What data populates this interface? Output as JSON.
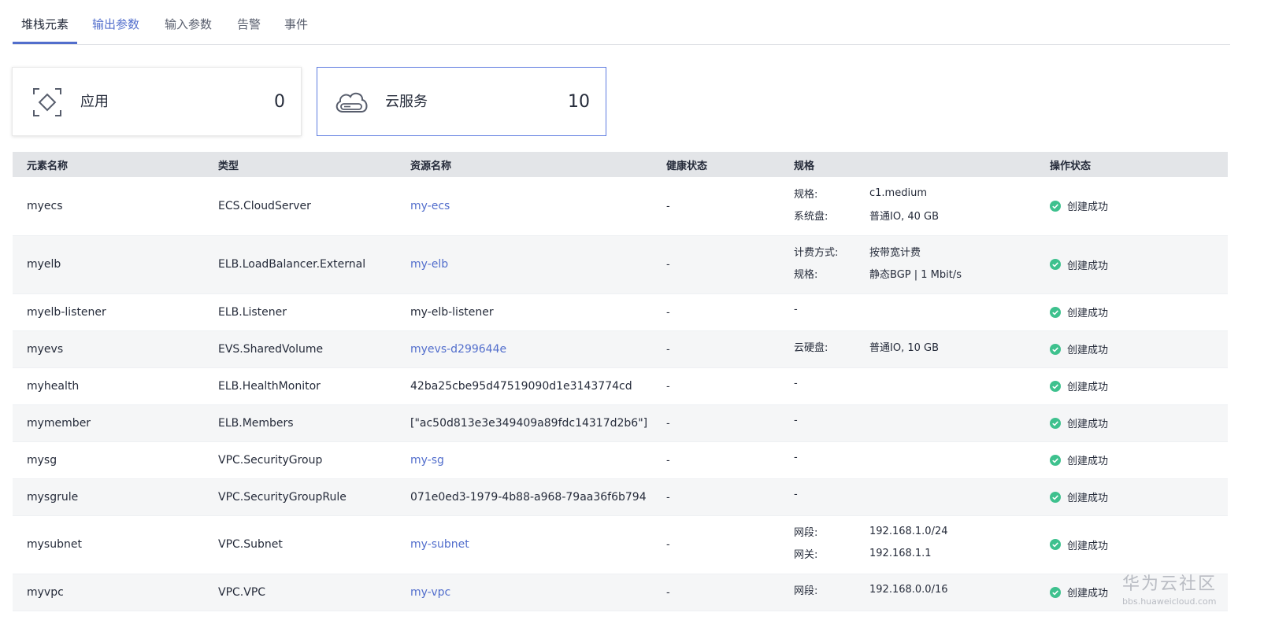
{
  "tabs": [
    {
      "label": "堆栈元素"
    },
    {
      "label": "输出参数"
    },
    {
      "label": "输入参数"
    },
    {
      "label": "告警"
    },
    {
      "label": "事件"
    }
  ],
  "cards": {
    "app": {
      "label": "应用",
      "count": "0",
      "icon": "app-frame-icon"
    },
    "cloud": {
      "label": "云服务",
      "count": "10",
      "icon": "cloud-icon"
    }
  },
  "table": {
    "headers": [
      "元素名称",
      "类型",
      "资源名称",
      "健康状态",
      "规格",
      "操作状态"
    ],
    "rows": [
      {
        "name": "myecs",
        "type": "ECS.CloudServer",
        "resource": "my-ecs",
        "resource_link": true,
        "health": "-",
        "status": "创建成功",
        "spec": [
          {
            "k": "规格:",
            "v": "c1.medium"
          },
          {
            "k": "系统盘:",
            "v": "普通IO, 40 GB"
          }
        ]
      },
      {
        "name": "myelb",
        "type": "ELB.LoadBalancer.External",
        "resource": "my-elb",
        "resource_link": true,
        "health": "-",
        "status": "创建成功",
        "spec": [
          {
            "k": "计费方式:",
            "v": "按带宽计费"
          },
          {
            "k": "规格:",
            "v": "静态BGP | 1 Mbit/s"
          }
        ]
      },
      {
        "name": "myelb-listener",
        "type": "ELB.Listener",
        "resource": "my-elb-listener",
        "resource_link": false,
        "health": "-",
        "status": "创建成功",
        "spec_text": "-"
      },
      {
        "name": "myevs",
        "type": "EVS.SharedVolume",
        "resource": "myevs-d299644e",
        "resource_link": true,
        "health": "-",
        "status": "创建成功",
        "spec": [
          {
            "k": "云硬盘:",
            "v": "普通IO, 10 GB"
          }
        ]
      },
      {
        "name": "myhealth",
        "type": "ELB.HealthMonitor",
        "resource": "42ba25cbe95d47519090d1e3143774cd",
        "resource_link": false,
        "health": "-",
        "status": "创建成功",
        "spec_text": "-"
      },
      {
        "name": "mymember",
        "type": "ELB.Members",
        "resource": "[\"ac50d813e3e349409a89fdc14317d2b6\"]",
        "resource_link": false,
        "health": "-",
        "status": "创建成功",
        "spec_text": "-"
      },
      {
        "name": "mysg",
        "type": "VPC.SecurityGroup",
        "resource": "my-sg",
        "resource_link": true,
        "health": "-",
        "status": "创建成功",
        "spec_text": "-"
      },
      {
        "name": "mysgrule",
        "type": "VPC.SecurityGroupRule",
        "resource": "071e0ed3-1979-4b88-a968-79aa36f6b794",
        "resource_link": false,
        "health": "-",
        "status": "创建成功",
        "spec_text": "-"
      },
      {
        "name": "mysubnet",
        "type": "VPC.Subnet",
        "resource": "my-subnet",
        "resource_link": true,
        "health": "-",
        "status": "创建成功",
        "spec": [
          {
            "k": "网段:",
            "v": "192.168.1.0/24"
          },
          {
            "k": "网关:",
            "v": "192.168.1.1"
          }
        ]
      },
      {
        "name": "myvpc",
        "type": "VPC.VPC",
        "resource": "my-vpc",
        "resource_link": true,
        "health": "-",
        "status": "创建成功",
        "spec": [
          {
            "k": "网段:",
            "v": "192.168.0.0/16"
          }
        ]
      }
    ]
  },
  "watermark": {
    "title": "华为云社区",
    "url": "bbs.huaweicloud.com"
  },
  "colors": {
    "accent": "#526ecc",
    "success": "#3ec18e",
    "header_bg": "#e3e5e8"
  }
}
